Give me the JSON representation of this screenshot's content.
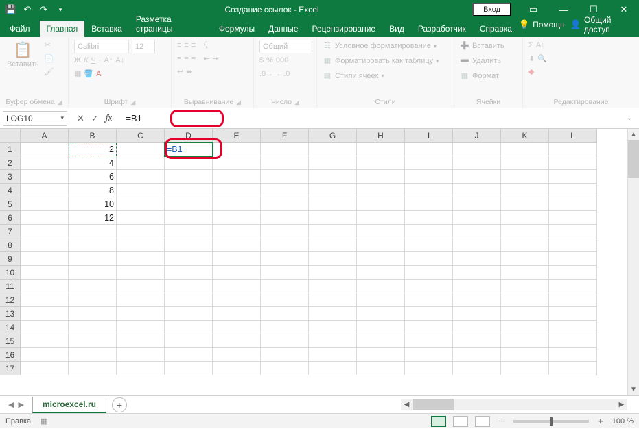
{
  "title": "Создание ссылок  -  Excel",
  "login": "Вход",
  "tabs": {
    "file": "Файл",
    "home": "Главная",
    "insert": "Вставка",
    "layout": "Разметка страницы",
    "formulas": "Формулы",
    "data": "Данные",
    "review": "Рецензирование",
    "view": "Вид",
    "developer": "Разработчик",
    "help": "Справка",
    "tell_me": "Помощн",
    "share": "Общий доступ"
  },
  "ribbon": {
    "clipboard": {
      "paste": "Вставить",
      "label": "Буфер обмена"
    },
    "font": {
      "name": "Calibri",
      "size": "12",
      "label": "Шрифт"
    },
    "alignment": {
      "label": "Выравнивание"
    },
    "number": {
      "format": "Общий",
      "label": "Число"
    },
    "styles": {
      "cond": "Условное форматирование",
      "table": "Форматировать как таблицу",
      "cell": "Стили ячеек",
      "label": "Стили"
    },
    "cells": {
      "insert": "Вставить",
      "delete": "Удалить",
      "format": "Формат",
      "label": "Ячейки"
    },
    "editing": {
      "label": "Редактирование"
    }
  },
  "name_box": "LOG10",
  "formula": "=B1",
  "active_cell_text": "=B1",
  "columns": [
    "A",
    "B",
    "C",
    "D",
    "E",
    "F",
    "G",
    "H",
    "I",
    "J",
    "K",
    "L"
  ],
  "rows": [
    "1",
    "2",
    "3",
    "4",
    "5",
    "6",
    "7",
    "8",
    "9",
    "10",
    "11",
    "12",
    "13",
    "14",
    "15",
    "16",
    "17"
  ],
  "data_b": [
    "2",
    "4",
    "6",
    "8",
    "10",
    "12"
  ],
  "sheet": {
    "name": "microexcel.ru"
  },
  "status": {
    "mode": "Правка",
    "zoom": "100 %"
  }
}
